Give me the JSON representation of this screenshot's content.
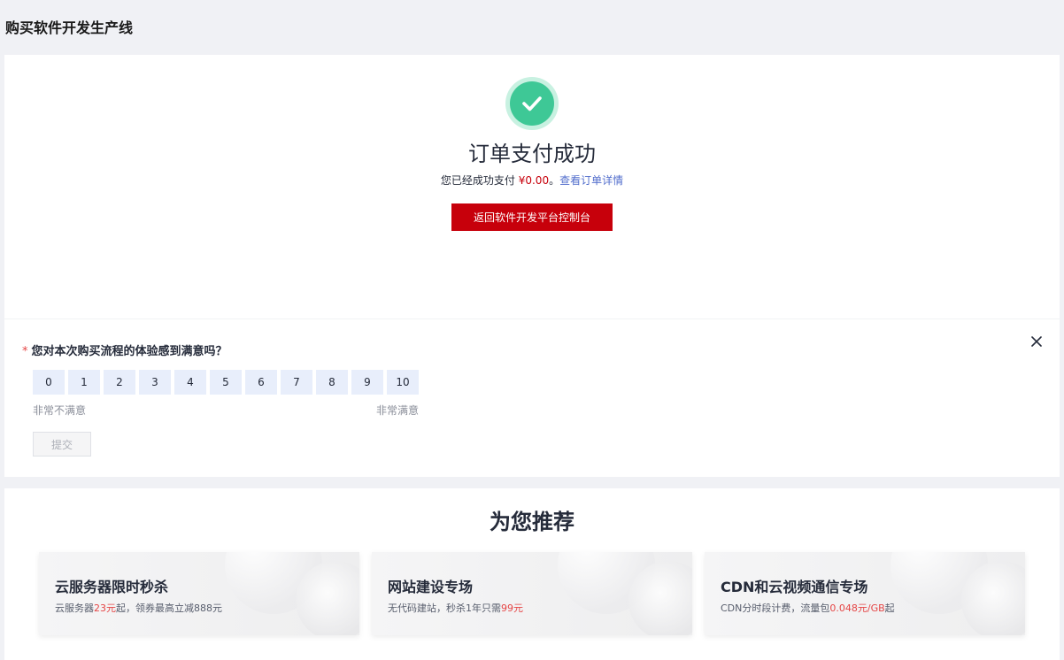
{
  "page": {
    "title": "购买软件开发生产线"
  },
  "success": {
    "title": "订单支付成功",
    "sub_prefix": "您已经成功支付 ",
    "amount": "¥0.00",
    "sub_sep": "。",
    "detail_link": "查看订单详情",
    "return_button": "返回软件开发平台控制台"
  },
  "survey": {
    "required_mark": "*",
    "question": "您对本次购买流程的体验感到满意吗？",
    "scores": [
      "0",
      "1",
      "2",
      "3",
      "4",
      "5",
      "6",
      "7",
      "8",
      "9",
      "10"
    ],
    "label_min": "非常不满意",
    "label_max": "非常满意",
    "submit": "提交"
  },
  "recommend": {
    "title": "为您推荐",
    "cards": [
      {
        "title": "云服务器限时秒杀",
        "desc_a": "云服务器",
        "desc_hl": "23元",
        "desc_b": "起，领券最高立减888元"
      },
      {
        "title": "网站建设专场",
        "desc_a": "无代码建站，秒杀1年只需",
        "desc_hl": "99元",
        "desc_b": ""
      },
      {
        "title": "CDN和云视频通信专场",
        "desc_a": "CDN分时段计费，流量包",
        "desc_hl": "0.048元/GB",
        "desc_b": "起"
      }
    ]
  },
  "colors": {
    "accent": "#c7000b",
    "success": "#3ec896",
    "link": "#526ecc"
  }
}
